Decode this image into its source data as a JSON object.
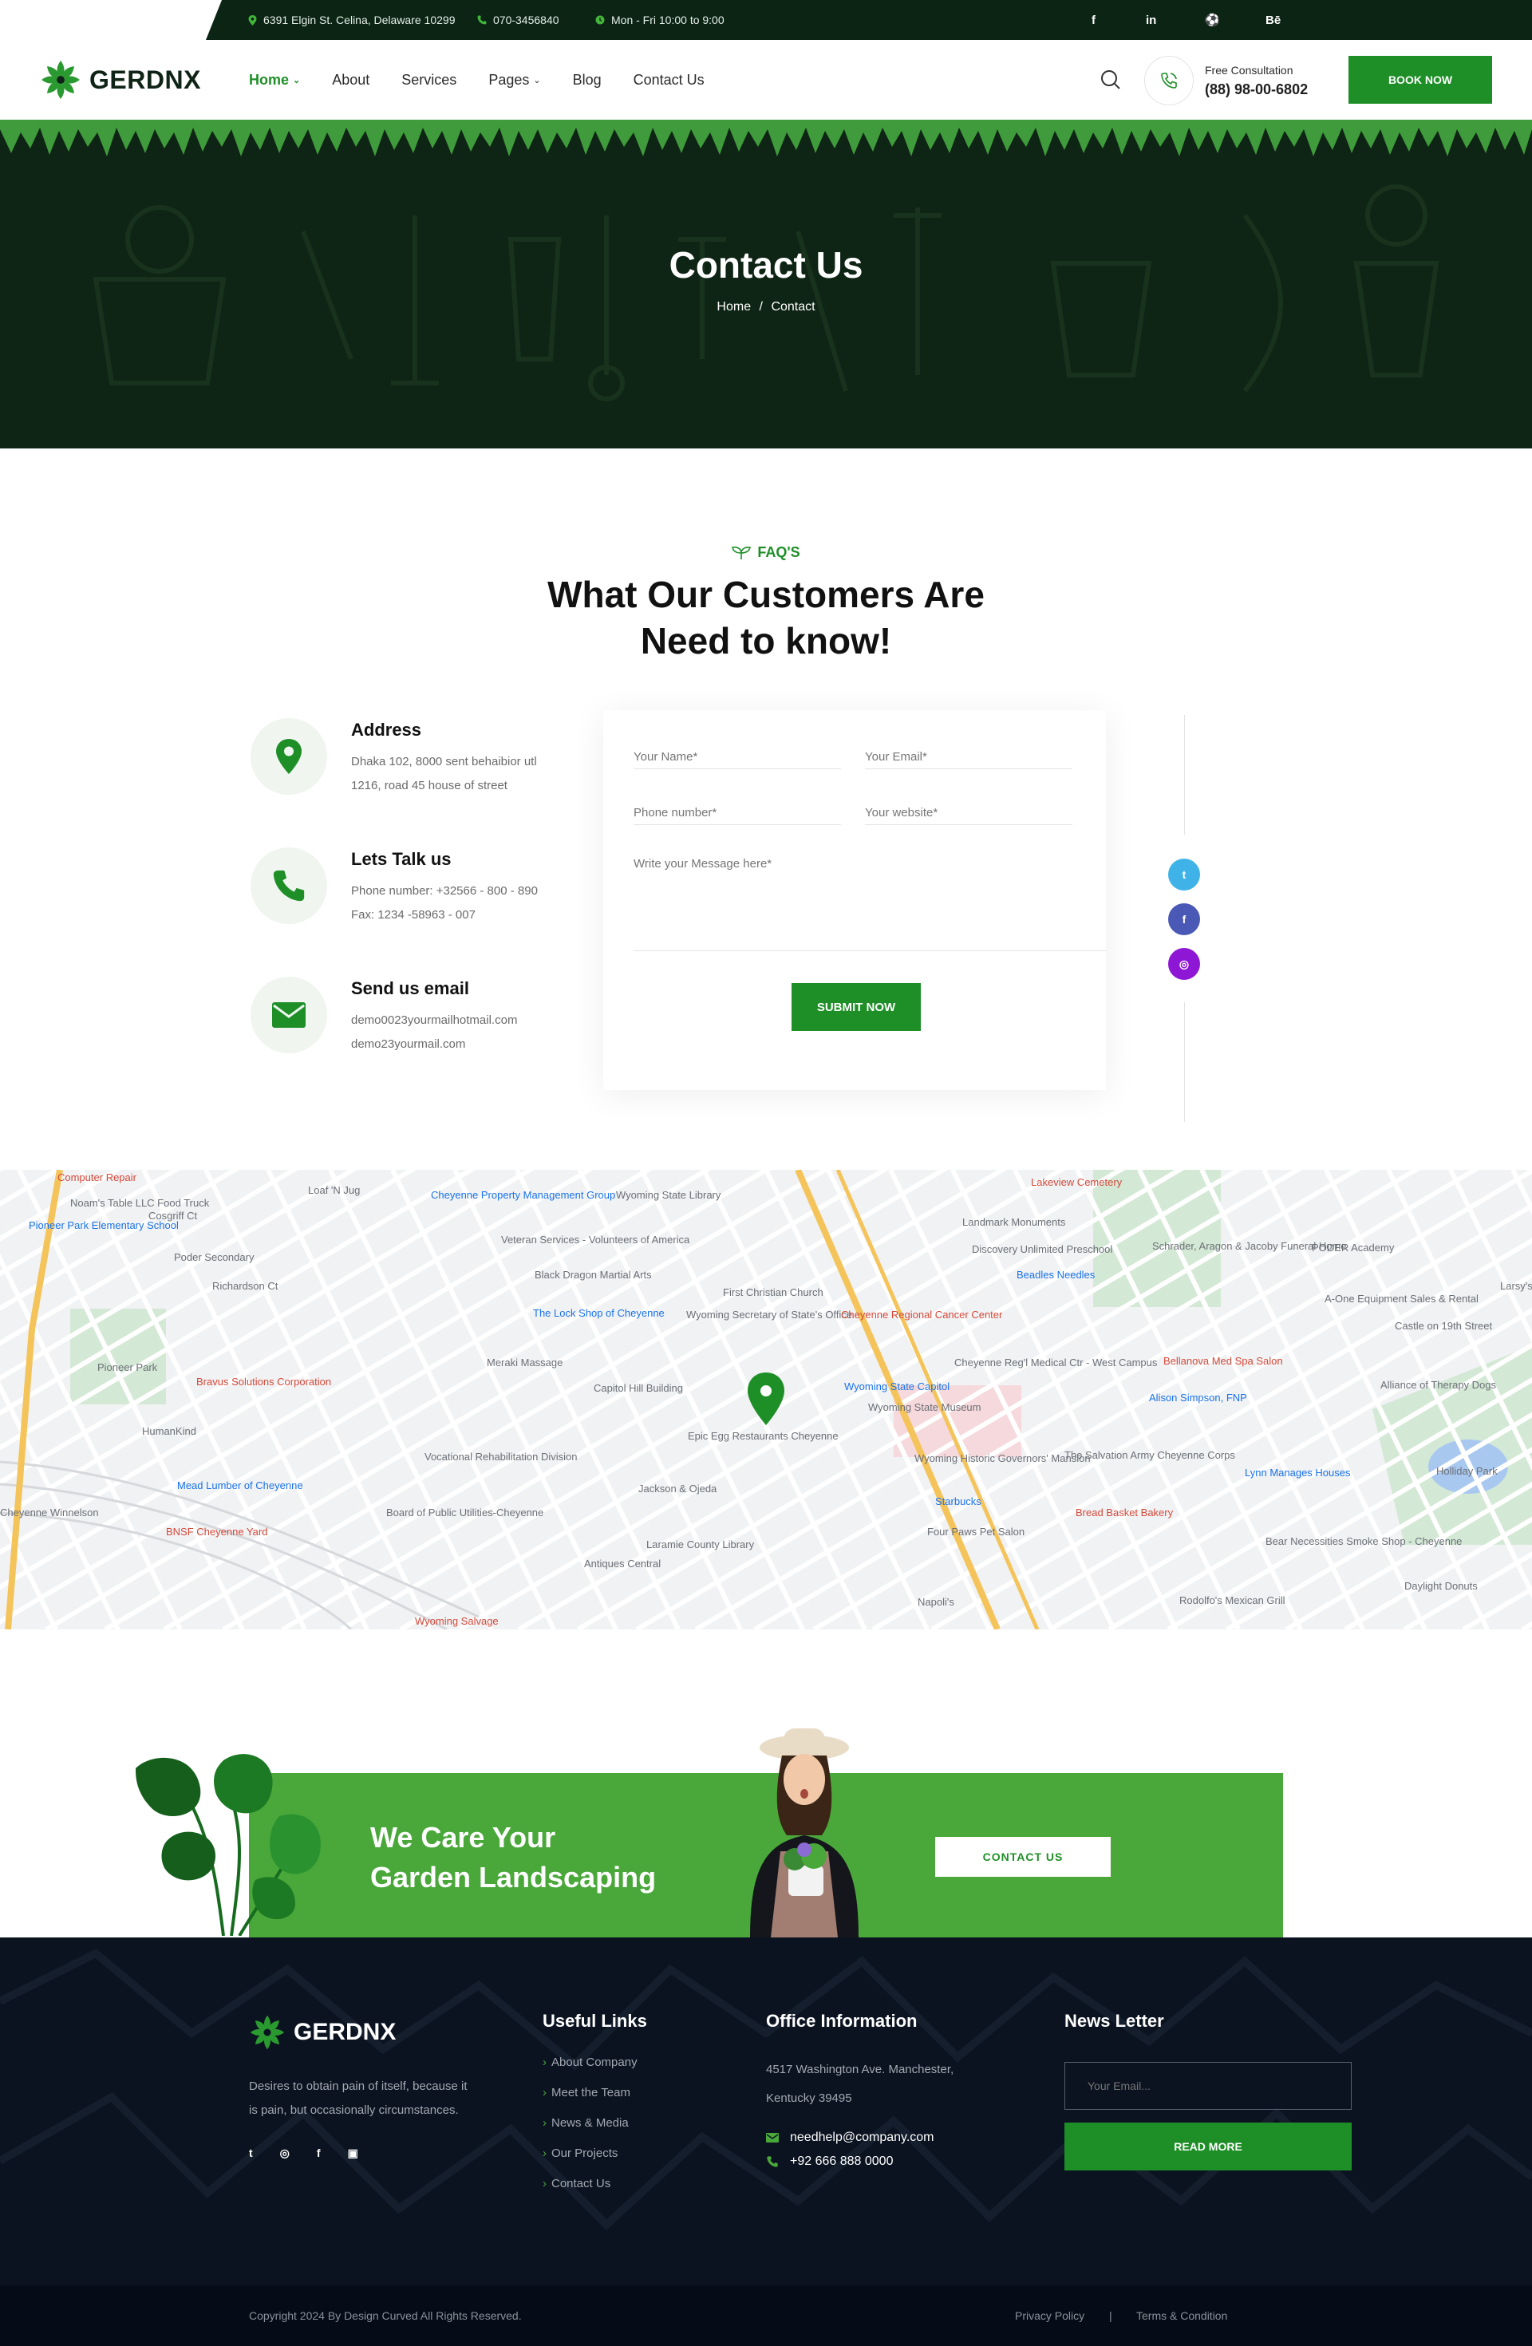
{
  "topbar": {
    "address": "6391 Elgin St. Celina, Delaware 10299",
    "phone": "070-3456840",
    "hours": "Mon - Fri 10:00 to 9:00",
    "social": [
      "f",
      "in",
      "⚽",
      "Bē"
    ]
  },
  "header": {
    "brand": "GERDNX",
    "nav": [
      "Home",
      "About",
      "Services",
      "Pages",
      "Blog",
      "Contact Us"
    ],
    "consult_label": "Free Consultation",
    "consult_phone": "(88) 98-00-6802",
    "book_label": "BOOK NOW"
  },
  "hero": {
    "title": "Contact Us",
    "crumb_home": "Home",
    "crumb_sep": "/",
    "crumb_current": "Contact"
  },
  "faq": {
    "tag": "FAQ'S",
    "title_line1": "What Our Customers Are",
    "title_line2": "Need to know!"
  },
  "contact": {
    "items": [
      {
        "title": "Address",
        "line1": "Dhaka 102,  8000 sent behaibior utl",
        "line2": "1216, road 45 house of street"
      },
      {
        "title": "Lets Talk us",
        "line1": "Phone number: +32566 - 800 - 890",
        "line2": "Fax: 1234 -58963 - 007"
      },
      {
        "title": "Send us email",
        "line1": "demo0023yourmailhotmail.com",
        "line2": "demo23yourmail.com"
      }
    ]
  },
  "form": {
    "name_ph": "Your Name*",
    "email_ph": "Your Email*",
    "phone_ph": "Phone number*",
    "website_ph": "Your website*",
    "message_ph": "Write your Message here*",
    "submit_label": "SUBMIT NOW"
  },
  "side_social": [
    "t",
    "f",
    "◎"
  ],
  "map": {
    "labels": [
      "Wyoming State Library",
      "Cheyenne Property Management Group",
      "Lakeview Cemetery",
      "Landmark Monuments",
      "Veteran Services - Volunteers of America",
      "Black Dragon Martial Arts",
      "The Lock Shop of Cheyenne",
      "First Christian Church",
      "Wyoming Secretary of State's Office",
      "Cheyenne Regional Cancer Center",
      "Cheyenne Reg'l Medical Ctr - West Campus",
      "Wyoming State Capitol",
      "Wyoming State Museum",
      "Capitol Hill Building",
      "Meraki Massage",
      "Epic Egg Restaurants Cheyenne",
      "Bravus Solutions Corporation",
      "Pioneer Park",
      "HumanKind",
      "Vocational Rehabilitation Division",
      "Jackson & Ojeda",
      "Mead Lumber of Cheyenne",
      "Board of Public Utilities-Cheyenne",
      "BNSF Cheyenne Yard",
      "Laramie County Library",
      "Antiques Central",
      "Starbucks",
      "Four Paws Pet Salon",
      "Wyoming Historic Governors' Mansion",
      "The Salvation Army Cheyenne Corps",
      "Bread Basket Bakery",
      "Lynn Manages Houses",
      "Bear Necessities Smoke Shop - Cheyenne",
      "Rodolfo's Mexican Grill",
      "Daylight Donuts",
      "Holliday Park",
      "Alison Simpson, FNP",
      "Bellanova Med Spa Salon",
      "Castle on 19th Street",
      "A-One Equipment Sales & Rental",
      "PODER Academy",
      "Beadles Needles",
      "Discovery Unlimited Preschool",
      "Schrader, Aragon & Jacoby Funeral Home",
      "Computer Repair",
      "Noam's Table LLC Food Truck",
      "Pioneer Park Elementary School",
      "Poder Secondary",
      "Richardson Ct",
      "Loaf 'N Jug",
      "Cosgriff Ct",
      "Wyoming Salvage",
      "Napoli's",
      "Alliance of Therapy Dogs",
      "Cheyenne Winnelson",
      "Larsy's"
    ]
  },
  "cta": {
    "line1": "We Care Your",
    "line2": "Garden Landscaping",
    "button": "CONTACT US"
  },
  "footer": {
    "brand": "GERDNX",
    "about": "Desires to obtain pain of itself, because it is pain, but occasionally circumstances.",
    "useful_title": "Useful Links",
    "links": [
      "About Company",
      "Meet the Team",
      "News & Media",
      "Our Projects",
      "Contact Us"
    ],
    "office_title": "Office Information",
    "office_addr1": "4517 Washington Ave. Manchester,",
    "office_addr2": "Kentucky 39495",
    "office_email": "needhelp@company.com",
    "office_phone": "+92 666 888 0000",
    "news_title": "News Letter",
    "news_ph": "Your Email...",
    "news_btn": "READ MORE"
  },
  "copyright": {
    "text": "Copyright  2024 By Design Curved All Rights Reserved.",
    "privacy": "Privacy Policy",
    "sep": "|",
    "terms": "Terms & Condition"
  },
  "colors": {
    "green": "#1e8f27",
    "dark": "#0b2414",
    "footer": "#0b1320",
    "cta": "#4aa83b"
  }
}
